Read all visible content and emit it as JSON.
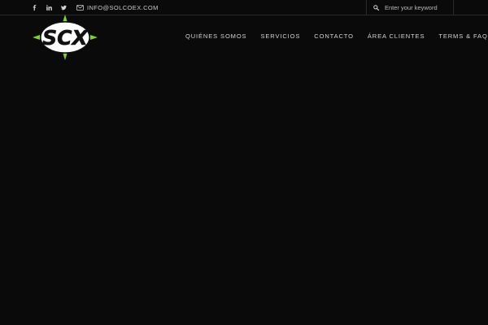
{
  "topbar": {
    "social": [
      {
        "name": "facebook-icon"
      },
      {
        "name": "linkedin-icon"
      },
      {
        "name": "twitter-icon"
      }
    ],
    "email": "INFO@SOLCOEX.COM",
    "search": {
      "placeholder": "Enter your keyword"
    }
  },
  "logo": {
    "text": "SCX"
  },
  "nav": {
    "items": [
      {
        "label": "QUIÉNES SOMOS"
      },
      {
        "label": "SERVICIOS"
      },
      {
        "label": "CONTACTO"
      },
      {
        "label": "ÁREA CLIENTES"
      },
      {
        "label": "TERMS & FAQS"
      }
    ]
  },
  "colors": {
    "background": "#0a0a0a",
    "accent_green": "#7bd62a",
    "text": "#d4d4d4"
  }
}
